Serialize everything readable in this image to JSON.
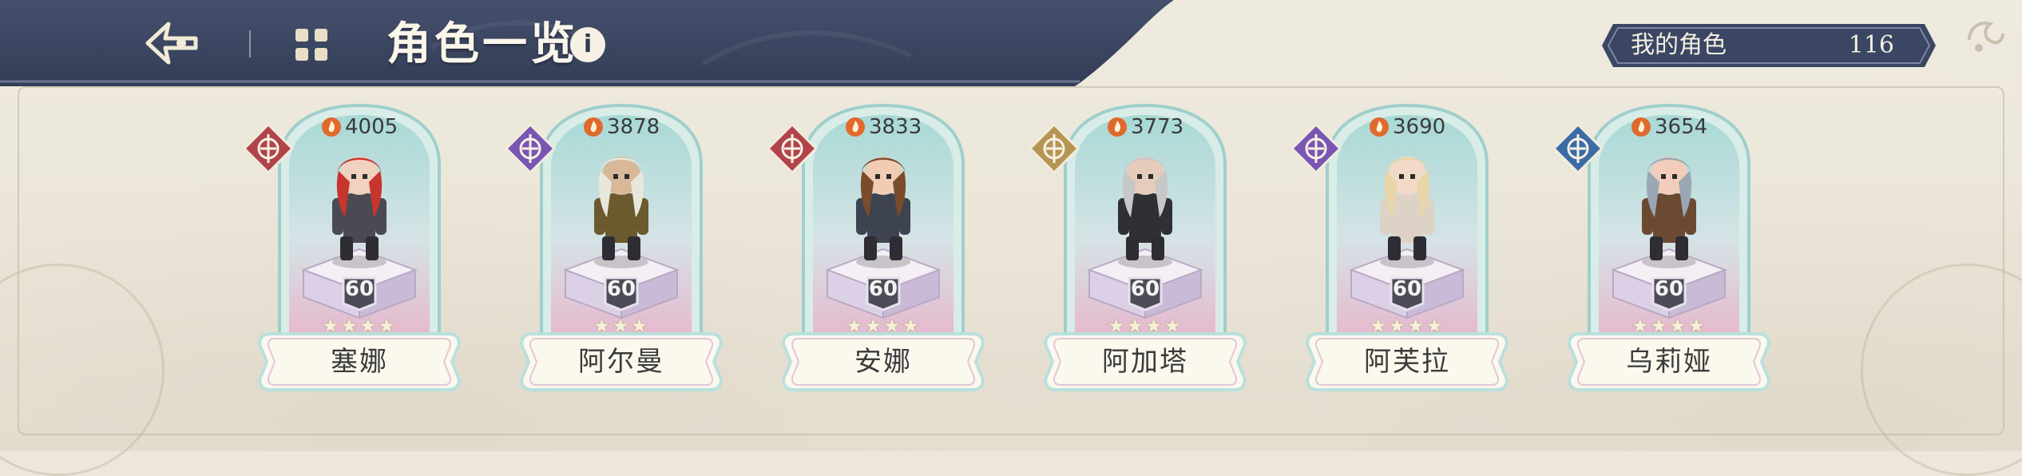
{
  "header": {
    "title": "角色一览",
    "back_icon": "back-arrow-icon",
    "menu_icon": "menu-grid-icon",
    "info_icon": "info-icon",
    "info_glyph": "i"
  },
  "counter": {
    "label": "我的角色",
    "value": "116"
  },
  "colors": {
    "header_bg": "#3a4663",
    "page_bg": "#ece7da",
    "card_teal": "#a8d9d5",
    "card_pink": "#e7b6cc",
    "name_plate": "#fbf8ee"
  },
  "characters": [
    {
      "name": "塞娜",
      "power": "4005",
      "level": "60",
      "stars": "★★★★",
      "element": "red-sword-icon",
      "element_color": "#b0444a"
    },
    {
      "name": "阿尔曼",
      "power": "3878",
      "level": "60",
      "stars": "★★★",
      "element": "purple-crescent-icon",
      "element_color": "#7a55b4"
    },
    {
      "name": "安娜",
      "power": "3833",
      "level": "60",
      "stars": "★★★★",
      "element": "red-sword-icon",
      "element_color": "#b0444a"
    },
    {
      "name": "阿加塔",
      "power": "3773",
      "level": "60",
      "stars": "★★★★",
      "element": "gold-star-icon",
      "element_color": "#b69554"
    },
    {
      "name": "阿芙拉",
      "power": "3690",
      "level": "60",
      "stars": "★★★★",
      "element": "purple-crescent-icon",
      "element_color": "#7a55b4"
    },
    {
      "name": "乌莉娅",
      "power": "3654",
      "level": "60",
      "stars": "★★★★",
      "element": "blue-cross-icon",
      "element_color": "#3b6ca8"
    }
  ]
}
